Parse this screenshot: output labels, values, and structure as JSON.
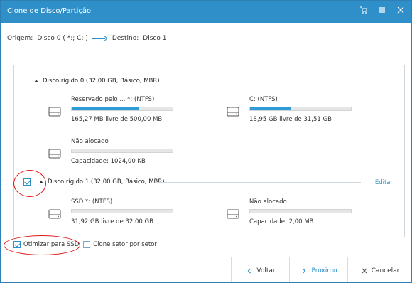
{
  "window": {
    "title": "Clone de Disco/Partição",
    "icons": [
      "cart-icon",
      "menu-icon",
      "close-icon"
    ]
  },
  "route": {
    "source_label": "Origem:",
    "source_value": "Disco 0 ( *:; C: )",
    "dest_label": "Destino:",
    "dest_value": "Disco 1"
  },
  "disks": [
    {
      "header": "Disco rígido 0 (32,00 GB, Básico, MBR)",
      "partitions": [
        {
          "name": "Reservado pelo ... *: (NTFS)",
          "info": "165,27 MB livre de 500,00 MB",
          "used_fraction": 0.67
        },
        {
          "name": "C: (NTFS)",
          "info": "18,95 GB livre de 31,51 GB",
          "used_fraction": 0.4
        },
        {
          "name": "Não alocado",
          "info": "Capacidade: 1024,00 KB",
          "used_fraction": 0
        }
      ]
    },
    {
      "header": "Disco rígido 1 (32,00 GB, Básico, MBR)",
      "edit_label": "Editar",
      "checked": true,
      "partitions": [
        {
          "name": "SSD *: (NTFS)",
          "info": "31,92 GB livre de 32,00 GB",
          "used_fraction": 0.01
        },
        {
          "name": "Não alocado",
          "info": "Capacidade: 2,00 MB",
          "used_fraction": 0
        }
      ]
    }
  ],
  "options": {
    "optimize_ssd": {
      "label": "Otimizar para SSD",
      "checked": true
    },
    "sector_clone": {
      "label": "Clone setor por setor",
      "checked": false
    }
  },
  "footer": {
    "back": "Voltar",
    "next": "Próximo",
    "cancel": "Cancelar"
  },
  "colors": {
    "accent": "#2f8fc9",
    "bar_fill": "#2f9bd6",
    "annotation": "#e01818"
  }
}
